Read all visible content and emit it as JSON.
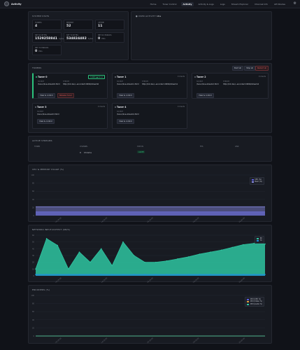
{
  "brand": {
    "name": "Activity"
  },
  "nav": [
    {
      "label": "Home",
      "active": false
    },
    {
      "label": "Tuner Control",
      "active": false
    },
    {
      "label": "Activity",
      "active": true
    },
    {
      "label": "Activity & Logs",
      "active": false
    },
    {
      "label": "Logs",
      "active": false
    },
    {
      "label": "Stream Explorer",
      "active": false
    },
    {
      "label": "Channel Info",
      "active": false
    },
    {
      "label": "API Routes",
      "active": false
    }
  ],
  "system": {
    "title": "SYSTEM STATS",
    "stats": [
      {
        "label": "TUNERS",
        "value": "4",
        "unit": ""
      },
      {
        "label": "MEMORY",
        "value": "52",
        "unit": ""
      },
      {
        "label": "UPTIME",
        "value": "11",
        "unit": ""
      },
      {
        "label": "NET RX BYTES",
        "value": "1529258841",
        "unit": "bytes"
      },
      {
        "label": "NET TX BYTES",
        "value": "534824482",
        "unit": "bytes"
      },
      {
        "label": "NET RX ERRORS",
        "value": "0",
        "unit": "Pkts"
      },
      {
        "label": "NET TX ERRORS",
        "value": "0",
        "unit": "Pkts"
      }
    ]
  },
  "user_activity": {
    "title": "USER ACTIVITY",
    "badge": "Idle"
  },
  "tuners": {
    "title": "TUNERS",
    "controls": {
      "start": "Start all",
      "stop": "Stop all",
      "restart": "Restart all"
    },
    "items": [
      {
        "name": "Tuner 0",
        "live": true,
        "status": "TUNED ● 00:17",
        "source_label": "SOURCE",
        "source": "/tuner/live-stream0.html",
        "url_label": "STREAM",
        "url": "http://10.dev/~encoder0:9090/stream0",
        "buttons": [
          "View & control",
          "Release tuner"
        ]
      },
      {
        "name": "Tuner 1",
        "live": false,
        "status": "0 clients",
        "source_label": "SOURCE",
        "source": "/tuner/live-stream1.html",
        "url_label": "STREAM",
        "url": "http://10.dev/~encoder1:9090/stream1",
        "buttons": [
          "View & control"
        ]
      },
      {
        "name": "Tuner 2",
        "live": false,
        "status": "0 clients",
        "source_label": "SOURCE",
        "source": "/tuner/live-stream2.html",
        "url_label": "STREAM",
        "url": "http://10.dev/~encoder2:9090/stream2",
        "buttons": [
          "View & control"
        ]
      },
      {
        "name": "Tuner 3",
        "live": false,
        "status": "0 clients",
        "source_label": "SOURCE",
        "source": "/tuner/live-stream3.html",
        "url_label": "",
        "url": "",
        "buttons": [
          "View & control"
        ]
      },
      {
        "name": "Tuner 4",
        "live": false,
        "status": "0 clients",
        "source_label": "SOURCE",
        "source": "/tuner/live-stream4.html",
        "url_label": "",
        "url": "",
        "buttons": [
          "View & control"
        ]
      }
    ]
  },
  "streams": {
    "title": "ACTIVE STREAMS",
    "columns": [
      "TUNER",
      "CHANNEL",
      "STATUS",
      "FPS",
      "LINK"
    ],
    "rows": [
      {
        "tuner": "0",
        "channel": "Chrome",
        "status": "ALIVE",
        "fps": "",
        "link": ""
      }
    ]
  },
  "colors": {
    "cpu": "#5b5ee0",
    "mem": "#8a8ce8",
    "net": "#2ec4a0",
    "rx": "#2ec4a0",
    "tx": "#1e8fd8"
  },
  "charts": {
    "cpu": {
      "title": "CPU & MEMORY USAGE (%)"
    },
    "net": {
      "title": "NETWORK INPUT/OUTPUT (KB/S)"
    },
    "enc": {
      "title": "ENCODERS (%)"
    }
  },
  "chart_data": [
    {
      "type": "area",
      "title": "CPU & MEMORY USAGE (%)",
      "x": [
        "14:18:00",
        "14:18:30",
        "14:19:00",
        "14:19:30",
        "14:20:00"
      ],
      "series": [
        {
          "name": "CPU (%)",
          "values": [
            9,
            9,
            9,
            9,
            9
          ]
        },
        {
          "name": "Mem (%)",
          "values": [
            22,
            22,
            22,
            22,
            22
          ]
        }
      ],
      "ylim": [
        0,
        100
      ],
      "yticks": [
        "100",
        "80",
        "60",
        "40",
        "20",
        "0"
      ],
      "legend": "top-right",
      "grid": true
    },
    {
      "type": "area",
      "title": "NETWORK INPUT/OUTPUT (KB/S)",
      "x": [
        "14:18:00",
        "14:18:30",
        "14:19:00",
        "14:19:30",
        "14:20:00"
      ],
      "series": [
        {
          "name": "RX",
          "values": [
            10,
            55,
            45,
            10,
            35,
            20,
            40,
            15,
            50,
            30,
            20,
            20,
            22,
            25,
            28,
            32,
            35,
            38,
            42,
            46,
            48,
            47
          ]
        },
        {
          "name": "TX",
          "values": [
            2,
            2,
            2,
            2,
            2,
            2,
            2,
            2,
            2,
            2,
            2,
            2,
            2,
            2,
            2,
            2,
            2,
            2,
            2,
            2,
            2,
            2
          ]
        }
      ],
      "ylim": [
        0,
        60
      ],
      "yticks": [
        "60",
        "50",
        "40",
        "30",
        "20",
        "10",
        "0"
      ],
      "legend": "top-right",
      "grid": true
    },
    {
      "type": "line",
      "title": "ENCODERS (%)",
      "x": [
        "14:18:00",
        "14:18:30",
        "14:19:00",
        "14:19:30",
        "14:20:00"
      ],
      "series": [
        {
          "name": "CPU (CPU %)",
          "values": [
            0,
            0,
            0,
            0,
            0
          ]
        },
        {
          "name": "CPU (Video %)",
          "values": [
            0,
            0,
            0,
            0,
            0
          ]
        },
        {
          "name": "CPU (Audio %)",
          "values": [
            0,
            0,
            0,
            0,
            0
          ]
        }
      ],
      "ylim": [
        0,
        100
      ],
      "yticks": [
        "100",
        "80",
        "60",
        "40",
        "20",
        "0"
      ],
      "legend": "top-right",
      "grid": true
    }
  ]
}
